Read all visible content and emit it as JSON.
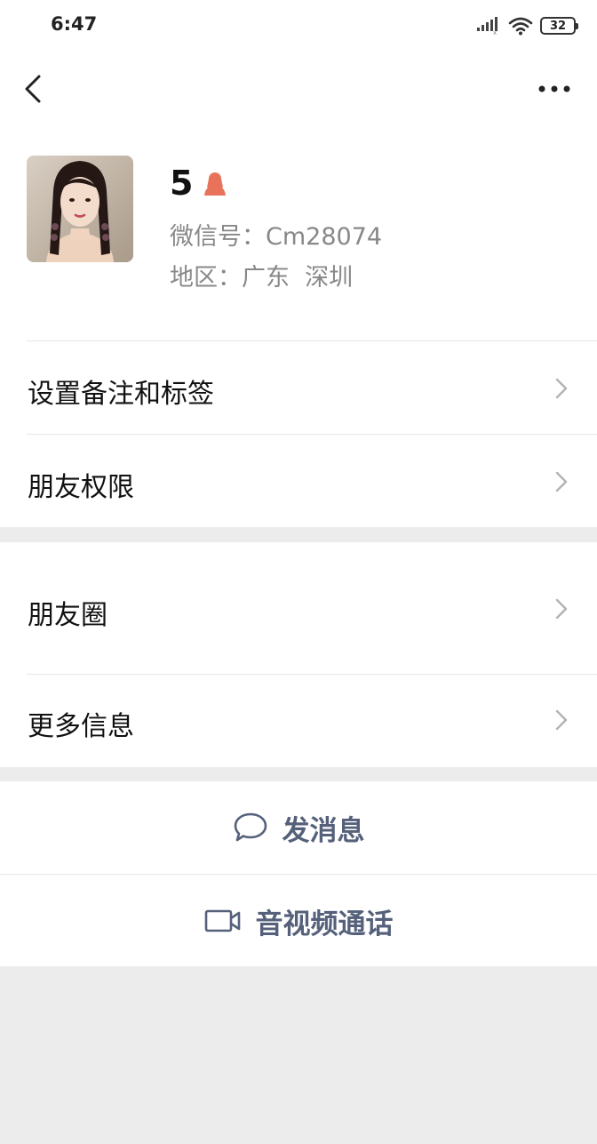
{
  "status_bar": {
    "time": "6:47",
    "battery": "32",
    "icons": [
      "signal-icon",
      "wifi-icon",
      "battery-icon"
    ]
  },
  "nav": {
    "back_icon": "chevron-left-icon",
    "more_icon": "more-horizontal-icon"
  },
  "profile": {
    "name": "5",
    "gender_icon": "female-contact-icon",
    "wechat_id": "微信号：Cm28074",
    "region": "地区：广东  深圳"
  },
  "menu_group_1": [
    {
      "label": "设置备注和标签"
    },
    {
      "label": "朋友权限"
    }
  ],
  "menu_group_2": [
    {
      "label": "朋友圈"
    },
    {
      "label": "更多信息"
    }
  ],
  "actions": {
    "message": {
      "label": "发消息",
      "icon": "chat-bubble-icon"
    },
    "video_call": {
      "label": "音视频通话",
      "icon": "video-camera-icon"
    }
  },
  "colors": {
    "action_text": "#55607a",
    "accent_icon": "#e8735a",
    "page_bg": "#ececec"
  }
}
